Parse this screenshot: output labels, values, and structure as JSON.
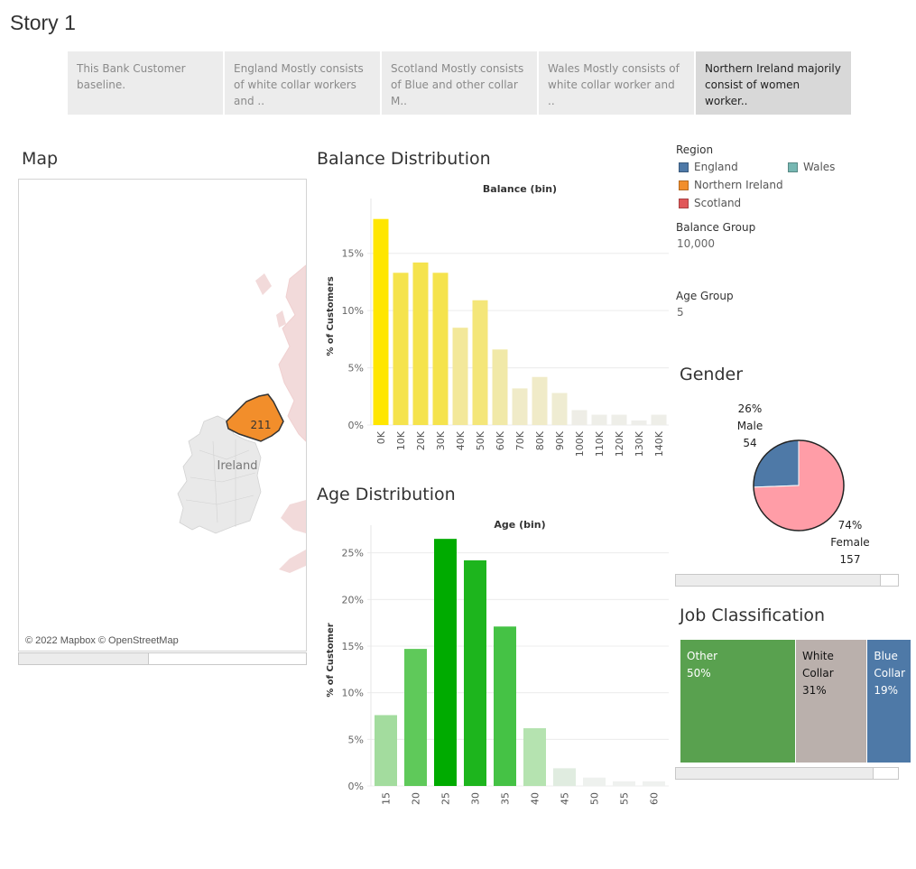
{
  "story": {
    "title": "Story 1",
    "tabs": [
      {
        "text": "This Bank Customer baseline.",
        "active": false
      },
      {
        "text": "England Mostly consists of white collar workers and ..",
        "active": false
      },
      {
        "text": "Scotland Mostly consists of Blue and other collar M..",
        "active": false
      },
      {
        "text": "Wales Mostly consists of white collar worker and ..",
        "active": false
      },
      {
        "text": "Northern Ireland majorily consist of women worker..",
        "active": true
      }
    ]
  },
  "map": {
    "title": "Map",
    "ireland_label": "Ireland",
    "highlight_value": "211",
    "highlight_color": "#f28e2b",
    "attribution": "© 2022 Mapbox © OpenStreetMap"
  },
  "legend": {
    "region_title": "Region",
    "regions": [
      {
        "name": "England",
        "color": "#4e79a7"
      },
      {
        "name": "Wales",
        "color": "#76b7b2"
      },
      {
        "name": "Northern Ireland",
        "color": "#f28e2b"
      },
      {
        "name": "Scotland",
        "color": "#e15759"
      }
    ],
    "balance_group_title": "Balance Group",
    "balance_group_value": "10,000",
    "age_group_title": "Age Group",
    "age_group_value": "5"
  },
  "charts_titles": {
    "balance": "Balance Distribution",
    "age": "Age Distribution",
    "gender": "Gender",
    "job": "Job Classification"
  },
  "chart_data": [
    {
      "type": "bar",
      "title": "Balance (bin)",
      "ylabel": "% of Customers",
      "categories": [
        "0K",
        "10K",
        "20K",
        "30K",
        "40K",
        "50K",
        "60K",
        "70K",
        "80K",
        "90K",
        "100K",
        "110K",
        "120K",
        "130K",
        "140K"
      ],
      "values": [
        18.0,
        13.3,
        14.2,
        13.3,
        8.5,
        10.9,
        6.6,
        3.2,
        4.2,
        2.8,
        1.3,
        0.9,
        0.9,
        0.4,
        0.9
      ],
      "yticks": [
        "0%",
        "5%",
        "10%",
        "15%"
      ],
      "ylim": [
        0,
        19
      ],
      "colors": [
        "#ffe600",
        "#f5e34d",
        "#f5e34d",
        "#f5e34d",
        "#f3e89a",
        "#f4e679",
        "#f1e9a8",
        "#f0ebc8",
        "#f0ebc8",
        "#efecd2",
        "#eeede6",
        "#eeeee8",
        "#eeeee8",
        "#eeeeea",
        "#eeeee8"
      ]
    },
    {
      "type": "bar",
      "title": "Age (bin)",
      "ylabel": "% of Customer",
      "categories": [
        "15",
        "20",
        "25",
        "30",
        "35",
        "40",
        "45",
        "50",
        "55",
        "60"
      ],
      "values": [
        7.6,
        14.7,
        26.5,
        24.2,
        17.1,
        6.2,
        1.9,
        0.9,
        0.5,
        0.5
      ],
      "yticks": [
        "0%",
        "5%",
        "10%",
        "15%",
        "20%",
        "25%"
      ],
      "ylim": [
        0,
        27
      ],
      "colors": [
        "#a3dc9e",
        "#5fc95a",
        "#00ab00",
        "#1db51d",
        "#45c245",
        "#b5e3b0",
        "#e0ece0",
        "#eef1ee",
        "#eff1ef",
        "#eff1ef"
      ]
    },
    {
      "type": "pie",
      "slices": [
        {
          "label": "Male",
          "percent_label": "26%",
          "count": "54",
          "value": 54,
          "color": "#4e79a7"
        },
        {
          "label": "Female",
          "percent_label": "74%",
          "count": "157",
          "value": 157,
          "color": "#ff9da7"
        }
      ]
    },
    {
      "type": "treemap",
      "items": [
        {
          "label": "Other",
          "value_label": "50%",
          "value": 50,
          "color": "#59a14f",
          "text_color": "#ffffff"
        },
        {
          "label": "White Collar",
          "value_label": "31%",
          "value": 31,
          "color": "#bab0ac",
          "text_color": "#111111"
        },
        {
          "label": "Blue Collar",
          "value_label": "19%",
          "value": 19,
          "color": "#4e79a7",
          "text_color": "#ffffff"
        }
      ]
    }
  ]
}
